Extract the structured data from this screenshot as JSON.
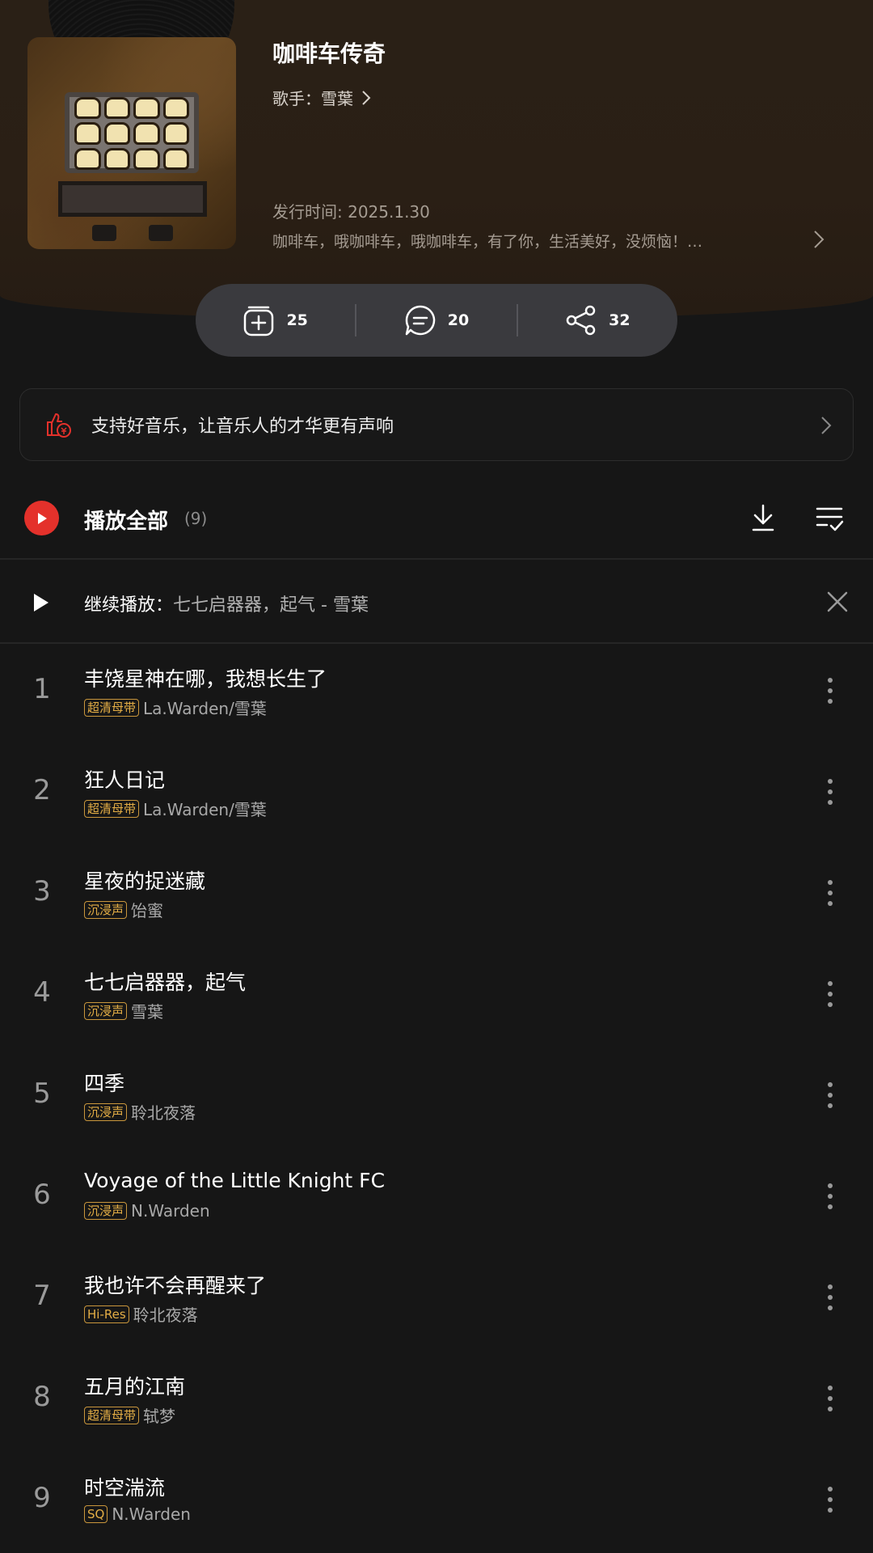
{
  "album": {
    "title": "咖啡车传奇",
    "artist_prefix": "歌手：",
    "artist_name": "雪葉",
    "release": "发行时间: 2025.1.30",
    "description": "咖啡车，哦咖啡车，哦咖啡车，有了你，生活美好，没烦恼！…"
  },
  "actions": {
    "collect_count": "25",
    "comment_count": "20",
    "share_count": "32"
  },
  "support": {
    "text": "支持好音乐，让音乐人的才华更有声响"
  },
  "playall": {
    "label": "播放全部",
    "count": "(9)"
  },
  "continue": {
    "prefix": "继续播放：",
    "song": "七七启器器，起气 - 雪葉"
  },
  "tracks": [
    {
      "index": "1",
      "title": "丰饶星神在哪，我想长生了",
      "tag": "超清母带",
      "artist": "La.Warden/雪葉"
    },
    {
      "index": "2",
      "title": "狂人日记",
      "tag": "超清母带",
      "artist": "La.Warden/雪葉"
    },
    {
      "index": "3",
      "title": "星夜的捉迷藏",
      "tag": "沉浸声",
      "artist": "饴蜜"
    },
    {
      "index": "4",
      "title": "七七启器器，起气",
      "tag": "沉浸声",
      "artist": "雪葉"
    },
    {
      "index": "5",
      "title": "四季",
      "tag": "沉浸声",
      "artist": "聆北夜落"
    },
    {
      "index": "6",
      "title": "Voyage of the Little Knight FC",
      "tag": "沉浸声",
      "artist": "N.Warden"
    },
    {
      "index": "7",
      "title": "我也许不会再醒来了",
      "tag": "Hi-Res",
      "artist": "聆北夜落"
    },
    {
      "index": "8",
      "title": "五月的江南",
      "tag": "超清母带",
      "artist": "轼梦"
    },
    {
      "index": "9",
      "title": "时空湍流",
      "tag": "SQ",
      "artist": "N.Warden"
    }
  ],
  "colors": {
    "accent": "#e4312b",
    "tag": "#e3ad45",
    "background": "#161616"
  },
  "icons": [
    "add-to-collection-icon",
    "comment-icon",
    "share-icon",
    "thumbs-up-coin-icon",
    "chevron-right-icon",
    "play-icon",
    "download-icon",
    "multi-select-icon",
    "close-icon",
    "more-vertical-icon"
  ]
}
